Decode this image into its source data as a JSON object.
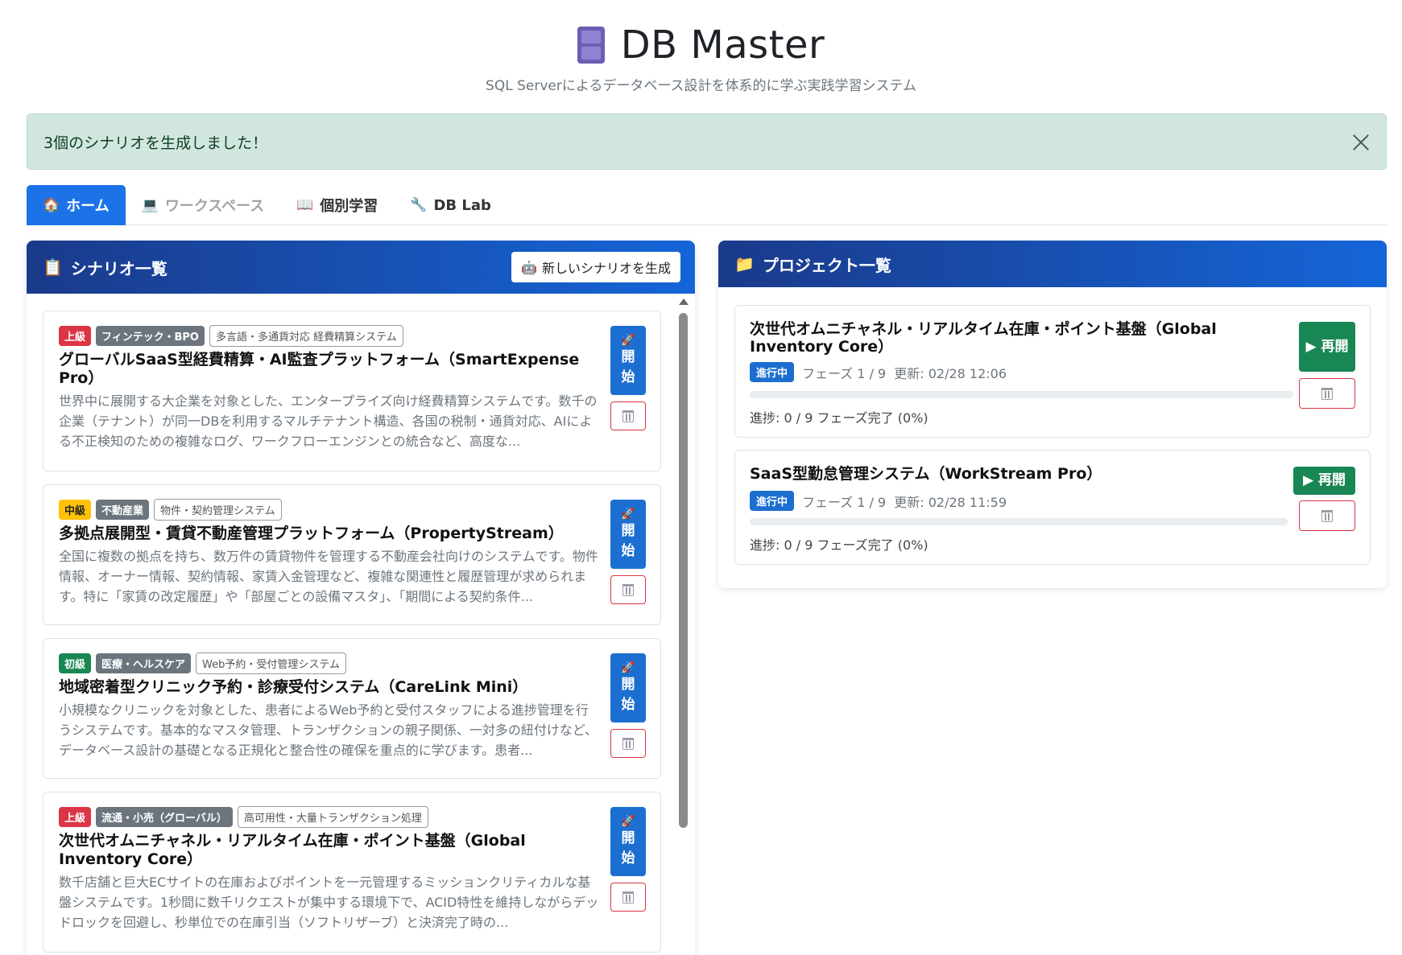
{
  "header": {
    "title": "DB Master",
    "subtitle": "SQL Serverによるデータベース設計を体系的に学ぶ実践学習システム"
  },
  "alert": {
    "message": "3個のシナリオを生成しました！"
  },
  "tabs": [
    {
      "label": "ホーム",
      "icon": "🏠"
    },
    {
      "label": "ワークスペース",
      "icon": "💻"
    },
    {
      "label": "個別学習",
      "icon": "📖"
    },
    {
      "label": "DB Lab",
      "icon": "🔧"
    }
  ],
  "scenarios": {
    "header": "シナリオ一覧",
    "header_icon": "📋",
    "generate_label": "新しいシナリオを生成",
    "generate_icon": "🤖",
    "start_label_1": "開",
    "start_label_2": "始",
    "items": [
      {
        "level": "上級",
        "industry": "フィンテック・BPO",
        "system": "多言語・多通貨対応 経費精算システム",
        "title": "グローバルSaaS型経費精算・AI監査プラットフォーム（SmartExpense Pro）",
        "desc": "世界中に展開する大企業を対象とした、エンタープライズ向け経費精算システムです。数千の企業（テナント）が同一DBを利用するマルチテナント構造、各国の税制・通貨対応、AIによる不正検知のための複雑なログ、ワークフローエンジンとの統合など、高度な..."
      },
      {
        "level": "中級",
        "industry": "不動産業",
        "system": "物件・契約管理システム",
        "title": "多拠点展開型・賃貸不動産管理プラットフォーム（PropertyStream）",
        "desc": "全国に複数の拠点を持ち、数万件の賃貸物件を管理する不動産会社向けのシステムです。物件情報、オーナー情報、契約情報、家賃入金管理など、複雑な関連性と履歴管理が求められます。特に「家賃の改定履歴」や「部屋ごとの設備マスタ」、「期間による契約条件..."
      },
      {
        "level": "初級",
        "industry": "医療・ヘルスケア",
        "system": "Web予約・受付管理システム",
        "title": "地域密着型クリニック予約・診療受付システム（CareLink Mini）",
        "desc": "小規模なクリニックを対象とした、患者によるWeb予約と受付スタッフによる進捗管理を行うシステムです。基本的なマスタ管理、トランザクションの親子関係、一対多の紐付けなど、データベース設計の基礎となる正規化と整合性の確保を重点的に学びます。患者..."
      },
      {
        "level": "上級",
        "industry": "流通・小売（グローバル）",
        "system": "高可用性・大量トランザクション処理",
        "title": "次世代オムニチャネル・リアルタイム在庫・ポイント基盤（Global Inventory Core）",
        "desc": "数千店舗と巨大ECサイトの在庫およびポイントを一元管理するミッションクリティカルな基盤システムです。1秒間に数千リクエストが集中する環境下で、ACID特性を維持しながらデッドロックを回避し、秒単位での在庫引当（ソフトリザーブ）と決済完了時の..."
      }
    ]
  },
  "projects": {
    "header": "プロジェクト一覧",
    "header_icon": "📁",
    "items": [
      {
        "title": "次世代オムニチャネル・リアルタイム在庫・ポイント基盤（Global Inventory Core）",
        "status": "進行中",
        "phase": "フェーズ 1 / 9",
        "updated": "更新: 02/28 12:06",
        "progress_text": "進捗: 0 / 9 フェーズ完了 (0%)",
        "progress": 0,
        "resume_label": "▶ 再開"
      },
      {
        "title": "SaaS型勤怠管理システム（WorkStream Pro）",
        "status": "進行中",
        "phase": "フェーズ 1 / 9",
        "updated": "更新: 02/28 11:59",
        "progress_text": "進捗: 0 / 9 フェーズ完了 (0%)",
        "progress": 0,
        "resume_label": "▶ 再開"
      }
    ]
  },
  "colors": {
    "accent": "#1c73e8",
    "header_dark": "#1a3a8a",
    "success": "#198754",
    "danger": "#dc3545",
    "warning": "#ffc107",
    "alert_bg": "#d1e7dd"
  }
}
